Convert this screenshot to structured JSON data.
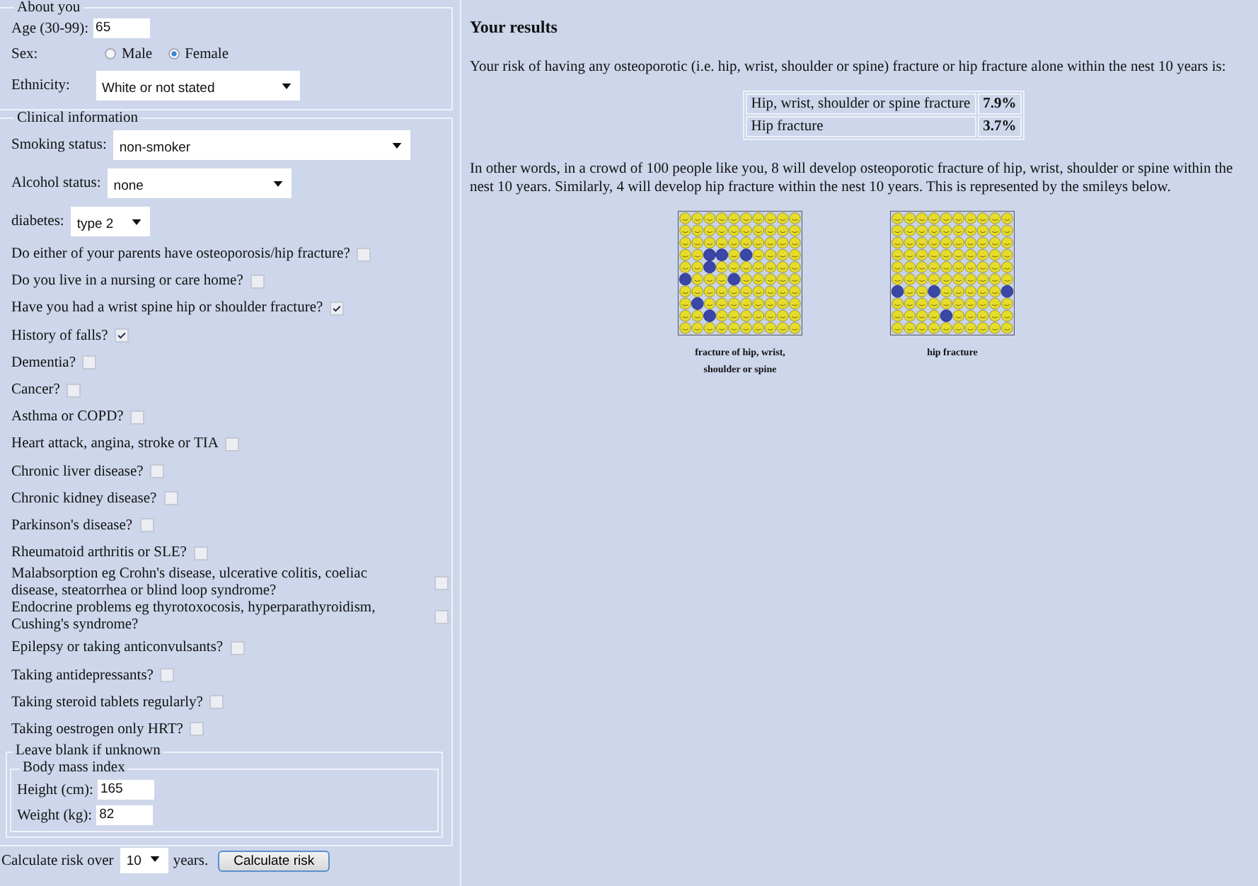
{
  "about": {
    "legend": "About you",
    "age": {
      "label": "Age (30-99):",
      "value": "65"
    },
    "sex": {
      "label": "Sex:",
      "options": [
        {
          "label": "Male",
          "selected": false
        },
        {
          "label": "Female",
          "selected": true
        }
      ]
    },
    "ethnicity": {
      "label": "Ethnicity:",
      "value": "White or not stated"
    }
  },
  "clinical": {
    "legend": "Clinical information",
    "selects": [
      {
        "label": "Smoking status:",
        "value": "non-smoker"
      },
      {
        "label": "Alcohol status:",
        "value": "none"
      },
      {
        "label": "diabetes:",
        "value": "type 2"
      }
    ],
    "questions": [
      {
        "label": "Do either of your parents have osteoporosis/hip fracture?",
        "checked": false
      },
      {
        "label": "Do you live in a nursing or care home?",
        "checked": false
      },
      {
        "label": "Have you had a wrist spine hip or shoulder fracture?",
        "checked": true
      },
      {
        "label": "History of falls?",
        "checked": true
      },
      {
        "label": "Dementia?",
        "checked": false
      },
      {
        "label": "Cancer?",
        "checked": false
      },
      {
        "label": "Asthma or COPD?",
        "checked": false
      },
      {
        "label": "Heart attack, angina, stroke or TIA",
        "checked": false
      },
      {
        "label": "Chronic liver disease?",
        "checked": false
      },
      {
        "label": "Chronic kidney disease?",
        "checked": false
      },
      {
        "label": "Parkinson's disease?",
        "checked": false
      },
      {
        "label": "Rheumatoid arthritis or SLE?",
        "checked": false
      },
      {
        "label": "Malabsorption eg Crohn's disease, ulcerative colitis, coeliac disease, steatorrhea or blind loop syndrome?",
        "checked": false,
        "kind": "long"
      },
      {
        "label": "Endocrine problems eg thyrotoxocosis, hyperparathyroidism, Cushing's syndrome?",
        "checked": false,
        "kind": "long"
      },
      {
        "label": "Epilepsy or taking anticonvulsants?",
        "checked": false
      },
      {
        "label": "Taking antidepressants?",
        "checked": false
      },
      {
        "label": "Taking steroid tablets regularly?",
        "checked": false
      },
      {
        "label": "Taking oestrogen only HRT?",
        "checked": false
      }
    ],
    "optional": {
      "legend": "Leave blank if unknown",
      "bmi_legend": "Body mass index",
      "fields": [
        {
          "label": "Height (cm):",
          "value": "165"
        },
        {
          "label": "Weight (kg):",
          "value": "82"
        }
      ]
    }
  },
  "calculate": {
    "prefix": "Calculate risk over",
    "years": "10",
    "suffix": "years.",
    "button": "Calculate risk"
  },
  "results": {
    "title": "Your results",
    "intro": "Your risk of having any osteoporotic (i.e. hip, wrist, shoulder or spine) fracture or hip fracture alone within the nest 10 years is:",
    "table": [
      {
        "label": "Hip, wrist, shoulder or spine fracture",
        "value": "7.9%"
      },
      {
        "label": "Hip fracture",
        "value": "3.7%"
      }
    ],
    "summary": "In other words, in a crowd of 100 people like you, 8 will develop osteoporotic fracture of hip, wrist, shoulder or spine within the nest 10 years. Similarly, 4 will develop hip fracture within the nest 10 years. This is represented by the smileys below.",
    "grids": [
      {
        "caption": "fracture of hip, wrist, shoulder or spine"
      },
      {
        "caption": "hip fracture"
      }
    ]
  }
}
